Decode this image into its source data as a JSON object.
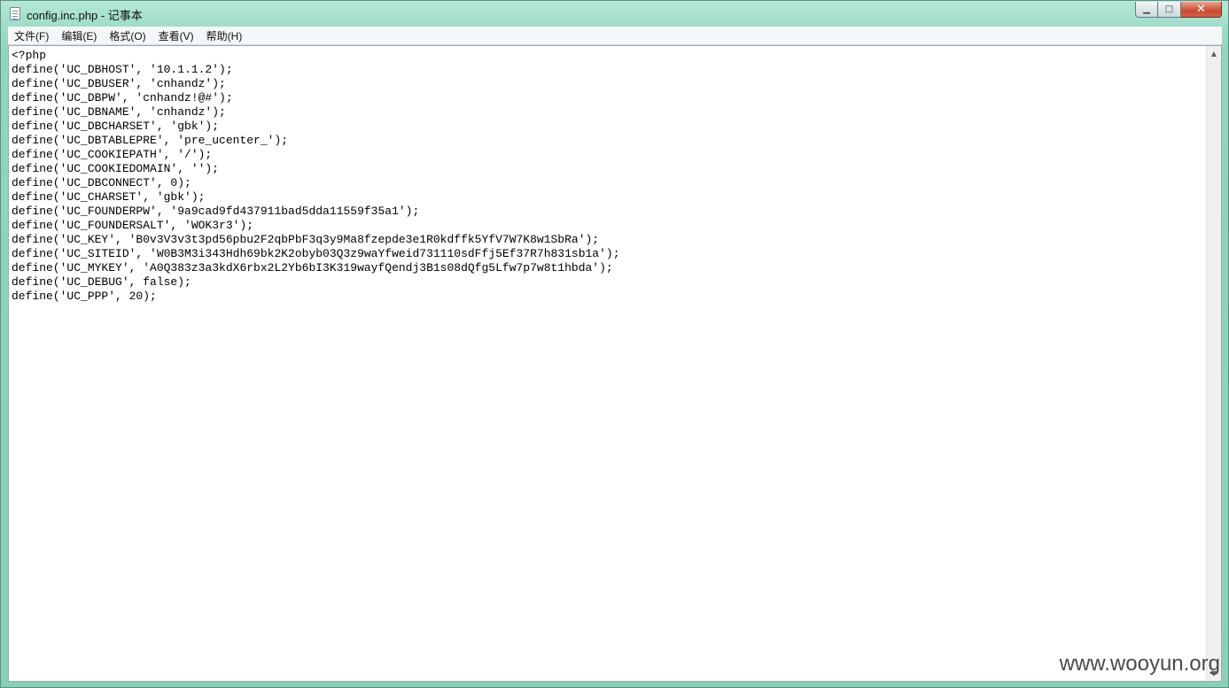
{
  "window": {
    "title": "config.inc.php - 记事本",
    "controls": {
      "minimize": "▁",
      "maximize": "□",
      "close": "✕"
    }
  },
  "menu": [
    {
      "id": "file",
      "label": "文件(F)"
    },
    {
      "id": "edit",
      "label": "编辑(E)"
    },
    {
      "id": "format",
      "label": "格式(O)"
    },
    {
      "id": "view",
      "label": "查看(V)"
    },
    {
      "id": "help",
      "label": "帮助(H)"
    }
  ],
  "editor": {
    "lines": [
      "<?php",
      "define('UC_DBHOST', '10.1.1.2');",
      "define('UC_DBUSER', 'cnhandz');",
      "define('UC_DBPW', 'cnhandz!@#');",
      "define('UC_DBNAME', 'cnhandz');",
      "define('UC_DBCHARSET', 'gbk');",
      "define('UC_DBTABLEPRE', 'pre_ucenter_');",
      "define('UC_COOKIEPATH', '/');",
      "define('UC_COOKIEDOMAIN', '');",
      "define('UC_DBCONNECT', 0);",
      "define('UC_CHARSET', 'gbk');",
      "define('UC_FOUNDERPW', '9a9cad9fd437911bad5dda11559f35a1');",
      "define('UC_FOUNDERSALT', 'WOK3r3');",
      "define('UC_KEY', 'B0v3V3v3t3pd56pbu2F2qbPbF3q3y9Ma8fzepde3e1R0kdffk5YfV7W7K8w1SbRa');",
      "define('UC_SITEID', 'W0B3M3i343Hdh69bk2K2obyb03Q3z9waYfweid731110sdFfj5Ef37R7h831sb1a');",
      "define('UC_MYKEY', 'A0Q383z3a3kdX6rbx2L2Yb6bI3K319wayfQendj3B1s08dQfg5Lfw7p7w8t1hbda');",
      "define('UC_DEBUG', false);",
      "define('UC_PPP', 20);"
    ]
  },
  "scrollbar": {
    "up_icon": "up-arrow",
    "down_icon": "down-arrow"
  },
  "watermark": "www.wooyun.org"
}
